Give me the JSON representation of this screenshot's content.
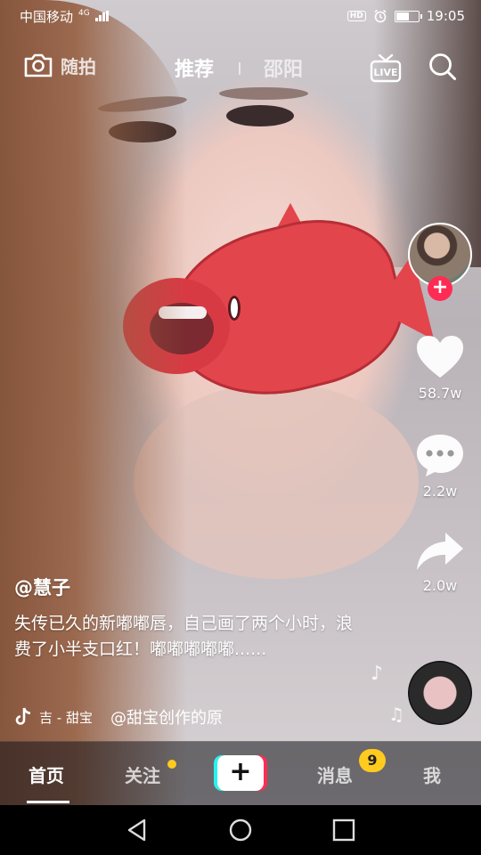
{
  "status_bar": {
    "carrier": "中国移动",
    "network": "4G",
    "hd": "HD",
    "time": "19:05",
    "battery_level": 0.55
  },
  "top_nav": {
    "camera_label": "随拍",
    "tabs": [
      {
        "label": "推荐",
        "active": true
      },
      {
        "label": "邵阳",
        "active": false
      }
    ],
    "live_label": "LIVE"
  },
  "post": {
    "author": "@慧子",
    "description": "失传已久的新嘟嘟唇，自己画了两个小时，浪费了小半支口红！嘟嘟嘟嘟嘟......",
    "music": {
      "prefix": "吉 - 甜宝",
      "source": "@甜宝创作的原"
    }
  },
  "rail": {
    "likes": "58.7w",
    "comments": "2.2w",
    "shares": "2.0w",
    "follow_symbol": "+"
  },
  "tab_bar": {
    "tabs": [
      {
        "key": "home",
        "label": "首页",
        "active": true
      },
      {
        "key": "following",
        "label": "关注",
        "active": false
      },
      {
        "key": "messages",
        "label": "消息",
        "active": false
      },
      {
        "key": "me",
        "label": "我",
        "active": false
      }
    ],
    "create_symbol": "+",
    "messages_badge": "9"
  },
  "colors": {
    "accent_pink": "#fe2c55",
    "accent_cyan": "#25f4ee",
    "badge_yellow": "#ffcb1f"
  }
}
